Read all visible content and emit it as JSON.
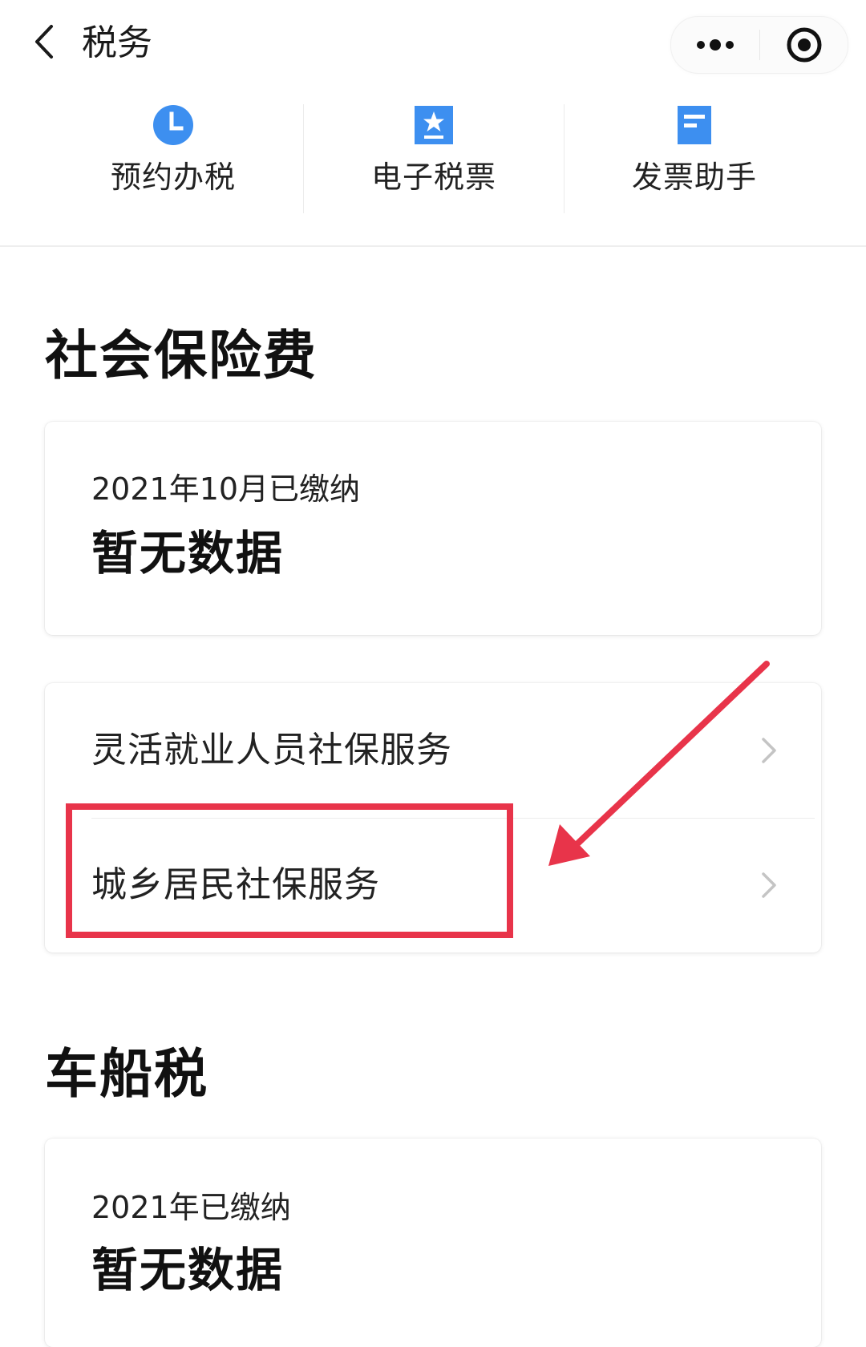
{
  "header": {
    "title": "税务",
    "back_icon": "chevron-left-icon",
    "more_icon": "more-dots-icon",
    "close_icon": "target-close-icon"
  },
  "quick_actions": [
    {
      "label": "预约办税",
      "icon": "clock-icon",
      "color": "#3d8ff0"
    },
    {
      "label": "电子税票",
      "icon": "star-ticket-icon",
      "color": "#3d8ff0"
    },
    {
      "label": "发票助手",
      "icon": "document-icon",
      "color": "#3d8ff0"
    }
  ],
  "social_insurance": {
    "section_title": "社会保险费",
    "summary": {
      "period_label": "2021年10月已缴纳",
      "value": "暂无数据"
    },
    "services": [
      {
        "label": "灵活就业人员社保服务",
        "icon": "chevron-right-icon"
      },
      {
        "label": "城乡居民社保服务",
        "icon": "chevron-right-icon",
        "highlighted": true
      }
    ]
  },
  "vehicle_tax": {
    "section_title": "车船税",
    "summary": {
      "period_label": "2021年已缴纳",
      "value": "暂无数据"
    }
  },
  "colors": {
    "accent_blue": "#3d8ff0",
    "annotation_red": "#e8344a"
  }
}
